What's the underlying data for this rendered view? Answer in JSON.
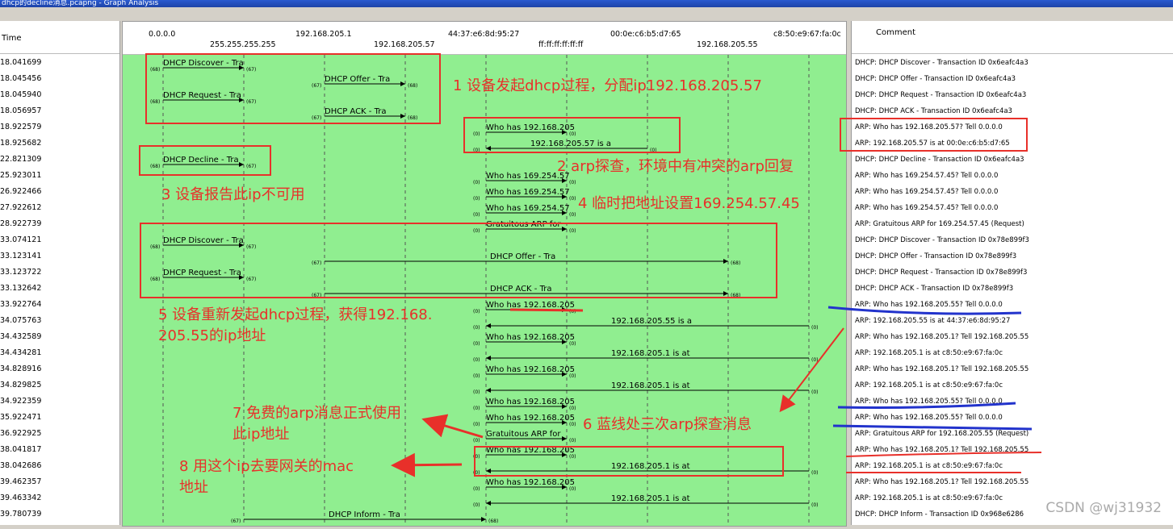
{
  "window": {
    "title": "dhcp的decline消息.pcapng - Graph Analysis"
  },
  "headers": {
    "time": "Time",
    "comment": "Comment"
  },
  "hosts_top": [
    "0.0.0.0",
    "192.168.205.1",
    "44:37:e6:8d:95:27",
    "00:0e:c6:b5:d7:65",
    "c8:50:e9:67:fa:0c"
  ],
  "hosts_bottom": [
    "255.255.255.255",
    "192.168.205.57",
    "ff:ff:ff:ff:ff:ff",
    "192.168.205.55"
  ],
  "rows": [
    {
      "time": "18.041699",
      "comment": "DHCP: DHCP Discover - Transaction ID 0x6eafc4a3"
    },
    {
      "time": "18.045456",
      "comment": "DHCP: DHCP Offer    - Transaction ID 0x6eafc4a3"
    },
    {
      "time": "18.045940",
      "comment": "DHCP: DHCP Request  - Transaction ID 0x6eafc4a3"
    },
    {
      "time": "18.056957",
      "comment": "DHCP: DHCP ACK      - Transaction ID 0x6eafc4a3"
    },
    {
      "time": "18.922579",
      "comment": "ARP: Who has 192.168.205.57?  Tell 0.0.0.0"
    },
    {
      "time": "18.925682",
      "comment": "ARP: 192.168.205.57 is at 00:0e:c6:b5:d7:65"
    },
    {
      "time": "22.821309",
      "comment": "DHCP: DHCP Decline  - Transaction ID 0x6eafc4a3"
    },
    {
      "time": "25.923011",
      "comment": "ARP: Who has 169.254.57.45?  Tell 0.0.0.0"
    },
    {
      "time": "26.922466",
      "comment": "ARP: Who has 169.254.57.45?  Tell 0.0.0.0"
    },
    {
      "time": "27.922612",
      "comment": "ARP: Who has 169.254.57.45?  Tell 0.0.0.0"
    },
    {
      "time": "28.922739",
      "comment": "ARP: Gratuitous ARP for 169.254.57.45 (Request)"
    },
    {
      "time": "33.074121",
      "comment": "DHCP: DHCP Discover - Transaction ID 0x78e899f3"
    },
    {
      "time": "33.123141",
      "comment": "DHCP: DHCP Offer    - Transaction ID 0x78e899f3"
    },
    {
      "time": "33.123722",
      "comment": "DHCP: DHCP Request  - Transaction ID 0x78e899f3"
    },
    {
      "time": "33.132642",
      "comment": "DHCP: DHCP ACK      - Transaction ID 0x78e899f3"
    },
    {
      "time": "33.922764",
      "comment": "ARP: Who has 192.168.205.55?  Tell 0.0.0.0"
    },
    {
      "time": "34.075763",
      "comment": "ARP: 192.168.205.55 is at 44:37:e6:8d:95:27"
    },
    {
      "time": "34.432589",
      "comment": "ARP: Who has 192.168.205.1?  Tell 192.168.205.55"
    },
    {
      "time": "34.434281",
      "comment": "ARP: 192.168.205.1 is at c8:50:e9:67:fa:0c"
    },
    {
      "time": "34.828916",
      "comment": "ARP: Who has 192.168.205.1?  Tell 192.168.205.55"
    },
    {
      "time": "34.829825",
      "comment": "ARP: 192.168.205.1 is at c8:50:e9:67:fa:0c"
    },
    {
      "time": "34.922359",
      "comment": "ARP: Who has 192.168.205.55?  Tell 0.0.0.0"
    },
    {
      "time": "35.922471",
      "comment": "ARP: Who has 192.168.205.55?  Tell 0.0.0.0"
    },
    {
      "time": "36.922925",
      "comment": "ARP: Gratuitous ARP for 192.168.205.55 (Request)"
    },
    {
      "time": "38.041817",
      "comment": "ARP: Who has 192.168.205.1?  Tell 192.168.205.55"
    },
    {
      "time": "38.042686",
      "comment": "ARP: 192.168.205.1 is at c8:50:e9:67:fa:0c"
    },
    {
      "time": "39.462357",
      "comment": "ARP: Who has 192.168.205.1?  Tell 192.168.205.55"
    },
    {
      "time": "39.463342",
      "comment": "ARP: 192.168.205.1 is at c8:50:e9:67:fa:0c"
    },
    {
      "time": "39.780739",
      "comment": "DHCP: DHCP Inform   - Transaction ID 0x968e6286"
    }
  ],
  "flows": [
    {
      "label": "DHCP Discover - Tra",
      "src": "(68)",
      "dst": "(67)"
    },
    {
      "label": "DHCP Offer    - Tra",
      "src": "(67)",
      "dst": "(68)"
    },
    {
      "label": "DHCP Request  - Tra",
      "src": "(68)",
      "dst": "(67)"
    },
    {
      "label": "DHCP ACK      - Tra",
      "src": "(67)",
      "dst": "(68)"
    },
    {
      "label": "Who has 192.168.205",
      "src": "(0)",
      "dst": "(0)"
    },
    {
      "label": "192.168.205.57 is a",
      "src": "(0)",
      "dst": "(0)"
    },
    {
      "label": "DHCP Decline  - Tra",
      "src": "(68)",
      "dst": "(67)"
    },
    {
      "label": "Who has 169.254.57",
      "src": "(0)",
      "dst": "(0)"
    },
    {
      "label": "Who has 169.254.57",
      "src": "(0)",
      "dst": "(0)"
    },
    {
      "label": "Who has 169.254.57",
      "src": "(0)",
      "dst": "(0)"
    },
    {
      "label": "Gratuitous ARP for",
      "src": "(0)",
      "dst": "(0)"
    },
    {
      "label": "DHCP Discover - Tra",
      "src": "(68)",
      "dst": "(67)"
    },
    {
      "label": "DHCP Offer    - Tra",
      "src": "(67)",
      "dst": "(68)"
    },
    {
      "label": "DHCP Request  - Tra",
      "src": "(68)",
      "dst": "(67)"
    },
    {
      "label": "DHCP ACK      - Tra",
      "src": "(67)",
      "dst": "(68)"
    },
    {
      "label": "Who has 192.168.205",
      "src": "(0)",
      "dst": "(0)"
    },
    {
      "label": "192.168.205.55 is a",
      "src": "(0)",
      "dst": "(0)"
    },
    {
      "label": "Who has 192.168.205",
      "src": "(0)",
      "dst": "(0)"
    },
    {
      "label": "192.168.205.1 is at",
      "src": "(0)",
      "dst": "(0)"
    },
    {
      "label": "Who has 192.168.205",
      "src": "(0)",
      "dst": "(0)"
    },
    {
      "label": "192.168.205.1 is at",
      "src": "(0)",
      "dst": "(0)"
    },
    {
      "label": "Who has 192.168.205",
      "src": "(0)",
      "dst": "(0)"
    },
    {
      "label": "Who has 192.168.205",
      "src": "(0)",
      "dst": "(0)"
    },
    {
      "label": "Gratuitous ARP for",
      "src": "(0)",
      "dst": "(0)"
    },
    {
      "label": "Who has 192.168.205",
      "src": "(0)",
      "dst": "(0)"
    },
    {
      "label": "192.168.205.1 is at",
      "src": "(0)",
      "dst": "(0)"
    },
    {
      "label": "Who has 192.168.205",
      "src": "(0)",
      "dst": "(0)"
    },
    {
      "label": "192.168.205.1 is at",
      "src": "(0)",
      "dst": "(0)"
    },
    {
      "label": "DHCP Inform   - Tra",
      "src": "(67)",
      "dst": "(68)"
    }
  ],
  "annotations": [
    "1 设备发起dhcp过程，分配ip192.168.205.57",
    "2 arp探查，环境中有冲突的arp回复",
    "3 设备报告此ip不可用",
    "4 临时把地址设置169.254.57.45",
    "5 设备重新发起dhcp过程，获得192.168.",
    "205.55的ip地址",
    "6 蓝线处三次arp探查消息",
    "7 免费的arp消息正式使用",
    "此ip地址",
    "8 用这个ip去要网关的mac",
    "地址"
  ],
  "watermark": "CSDN @wj31932",
  "colors": {
    "graph_bg": "#90ee90",
    "annotation_red": "#e8302a",
    "marker_blue": "#2233cc"
  }
}
